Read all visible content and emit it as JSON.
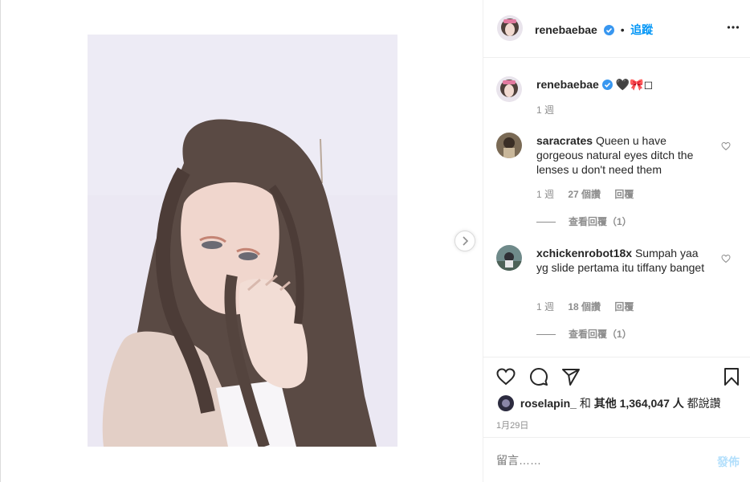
{
  "post": {
    "author": "renebaebae",
    "follow_label": "追蹤",
    "separator": "•"
  },
  "caption": {
    "username": "renebaebae",
    "text": "🖤🎀◻",
    "time": "1 週"
  },
  "comments": [
    {
      "username": "saracrates",
      "text": "Queen u have gorgeous natural eyes ditch the lenses u don't need them",
      "time": "1 週",
      "likes": "27 個讚",
      "reply_label": "回覆",
      "view_replies": "查看回覆（1）"
    },
    {
      "username": "xchickenrobot18x",
      "text": "Sumpah yaa yg slide pertama itu tiffany banget",
      "time": "1 週",
      "likes": "18 個讚",
      "reply_label": "回覆",
      "view_replies": "查看回覆（1）"
    }
  ],
  "likes_line": {
    "user": "roselapin_",
    "and": "和",
    "others": "其他 1,364,047 人",
    "suffix": "都說讚"
  },
  "date": "1月29日",
  "composer": {
    "placeholder": "留言……",
    "post_label": "發佈"
  },
  "colors": {
    "accent": "#0095f6",
    "verified": "#3897f0",
    "muted": "#8e8e8e",
    "post_disabled": "#b2dffc"
  },
  "icons": [
    "chevron-right-icon",
    "more-icon",
    "verified-icon",
    "heart-icon",
    "comment-icon",
    "share-icon",
    "bookmark-icon"
  ]
}
